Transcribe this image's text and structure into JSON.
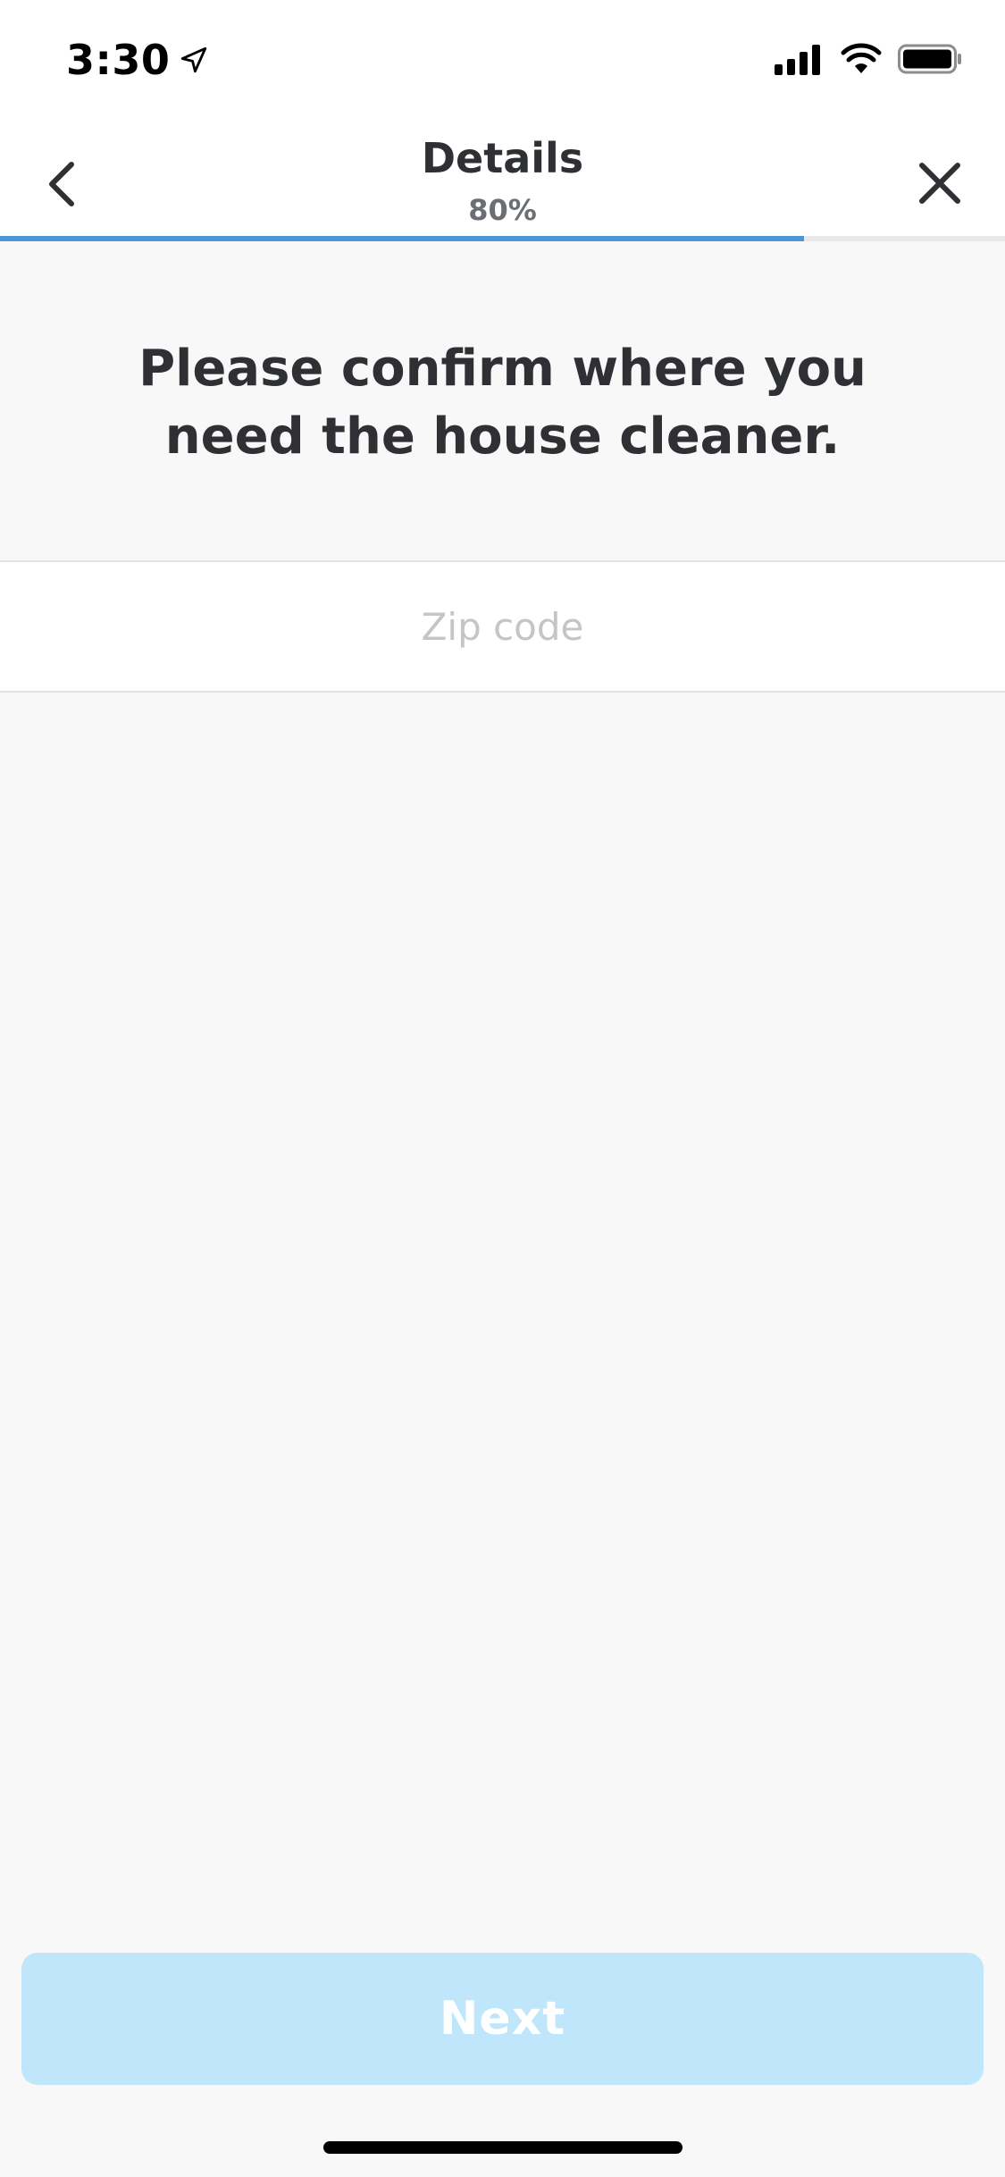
{
  "status_bar": {
    "time": "3:30",
    "icons": [
      "location-arrow-icon",
      "cellular-signal-icon",
      "wifi-icon",
      "battery-icon"
    ]
  },
  "nav": {
    "title": "Details",
    "progress_label": "80%",
    "progress_fraction": 0.8,
    "back_icon": "chevron-left-icon",
    "close_icon": "close-icon"
  },
  "prompt": {
    "text": "Please confirm where you need the house cleaner."
  },
  "zip_field": {
    "placeholder": "Zip code",
    "value": ""
  },
  "footer": {
    "next_label": "Next"
  },
  "colors": {
    "accent": "#4c97d6",
    "button_disabled": "#bfe6fb",
    "text_primary": "#2f3033",
    "placeholder": "#c4c5c7"
  }
}
